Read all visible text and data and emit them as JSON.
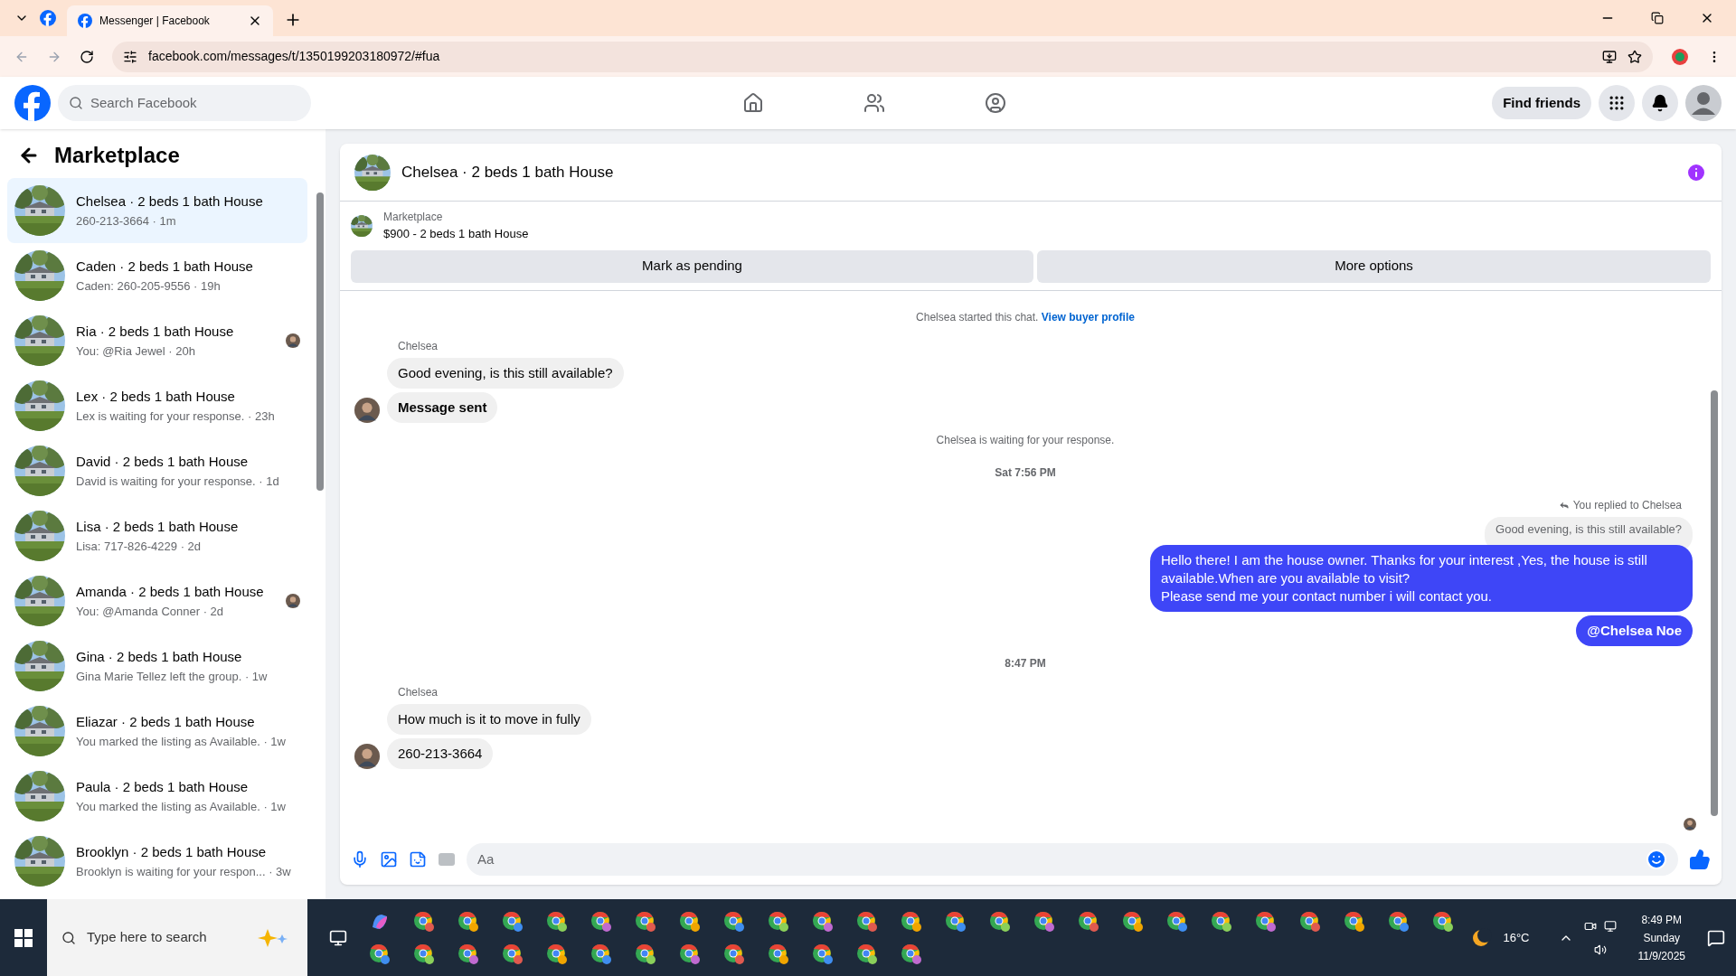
{
  "browser": {
    "tab_title": "Messenger | Facebook",
    "url": "facebook.com/messages/t/1350199203180972/#fua"
  },
  "header": {
    "search_placeholder": "Search Facebook",
    "find_friends": "Find friends"
  },
  "sidebar": {
    "title": "Marketplace",
    "items": [
      {
        "name": "Chelsea · 2 beds 1 bath House",
        "subtitle": "260-213-3664 · 1m",
        "selected": true,
        "seen": false
      },
      {
        "name": "Caden · 2 beds 1 bath House",
        "subtitle": "Caden: 260-205-9556 · 19h",
        "selected": false,
        "seen": false
      },
      {
        "name": "Ria · 2 beds 1 bath House",
        "subtitle": "You: @Ria Jewel · 20h",
        "selected": false,
        "seen": true
      },
      {
        "name": "Lex · 2 beds 1 bath House",
        "subtitle": "Lex is waiting for your response. · 23h",
        "selected": false,
        "seen": false
      },
      {
        "name": "David · 2 beds 1 bath House",
        "subtitle": "David is waiting for your response. · 1d",
        "selected": false,
        "seen": false
      },
      {
        "name": "Lisa · 2 beds 1 bath House",
        "subtitle": "Lisa: 717-826-4229 · 2d",
        "selected": false,
        "seen": false
      },
      {
        "name": "Amanda · 2 beds 1 bath House",
        "subtitle": "You: @Amanda Conner · 2d",
        "selected": false,
        "seen": true
      },
      {
        "name": "Gina · 2 beds 1 bath House",
        "subtitle": "Gina Marie Tellez left the group. · 1w",
        "selected": false,
        "seen": false
      },
      {
        "name": "Eliazar · 2 beds 1 bath House",
        "subtitle": "You marked the listing as Available. · 1w",
        "selected": false,
        "seen": false
      },
      {
        "name": "Paula · 2 beds 1 bath House",
        "subtitle": "You marked the listing as Available. · 1w",
        "selected": false,
        "seen": false
      },
      {
        "name": "Brooklyn · 2 beds 1 bath House",
        "subtitle": "Brooklyn is waiting for your respon... · 3w",
        "selected": false,
        "seen": false
      }
    ]
  },
  "chat": {
    "title": "Chelsea · 2 beds 1 bath House",
    "listing": {
      "label": "Marketplace",
      "price_title": "$900 - 2 beds 1 bath House"
    },
    "actions": [
      "Mark as pending",
      "More options"
    ],
    "messages": [
      {
        "kind": "system",
        "text": "Chelsea started this chat.",
        "link": "View buyer profile"
      },
      {
        "kind": "incoming",
        "sender": "Chelsea",
        "bubbles": [
          {
            "text": "Good evening, is this still available?",
            "bold": false
          },
          {
            "text": "Message sent",
            "bold": true
          }
        ]
      },
      {
        "kind": "system",
        "text": "Chelsea is waiting for your response."
      },
      {
        "kind": "timestamp",
        "text": "Sat 7:56 PM"
      },
      {
        "kind": "outgoing",
        "reply_note": "You replied to Chelsea",
        "quoted": "Good evening, is this still available?",
        "bubbles": [
          {
            "text": "Hello there! I am the house owner. Thanks for your interest ,Yes, the house is still available.When are you available to visit?\nPlease send me your contact number i will contact you.",
            "bold": false
          },
          {
            "text": "@Chelsea Noe",
            "bold": true
          }
        ]
      },
      {
        "kind": "timestamp",
        "text": "8:47 PM"
      },
      {
        "kind": "incoming",
        "sender": "Chelsea",
        "bubbles": [
          {
            "text": "How much is it to move in fully",
            "bold": false
          },
          {
            "text": "260-213-3664",
            "bold": false
          }
        ]
      }
    ],
    "composer_placeholder": "Aa"
  },
  "taskbar": {
    "search_placeholder": "Type here to search",
    "weather": "16°C",
    "time": "8:49 PM",
    "day": "Sunday",
    "date": "11/9/2025"
  }
}
